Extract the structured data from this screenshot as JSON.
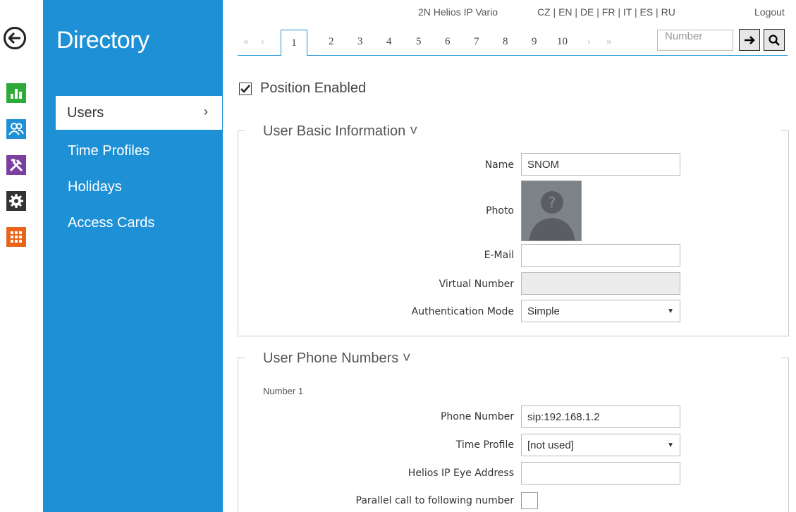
{
  "header": {
    "device_name": "2N Helios IP Vario",
    "languages": "CZ | EN | DE | FR | IT | ES | RU",
    "logout": "Logout"
  },
  "sidebar": {
    "title": "Directory",
    "items": [
      {
        "label": "Users",
        "active": true
      },
      {
        "label": "Time Profiles"
      },
      {
        "label": "Holidays"
      },
      {
        "label": "Access Cards"
      }
    ]
  },
  "rail": {
    "tiles": [
      {
        "icon": "status-chart-icon",
        "color": "#2eaa3a"
      },
      {
        "icon": "users-icon",
        "color": "#1e91d6"
      },
      {
        "icon": "tools-icon",
        "color": "#7b3fa0"
      },
      {
        "icon": "gear-icon",
        "color": "#333333"
      },
      {
        "icon": "grid-icon",
        "color": "#e8641b"
      }
    ]
  },
  "pager": {
    "first": "«",
    "prev": "‹",
    "pages": [
      "1",
      "2",
      "3",
      "4",
      "5",
      "6",
      "7",
      "8",
      "9",
      "10"
    ],
    "active": "1",
    "next": "›",
    "last": "»",
    "number_placeholder": "Number"
  },
  "content": {
    "position_enabled_label": "Position Enabled",
    "position_enabled_checked": true,
    "basic_info": {
      "title": "User Basic Information ˅",
      "name_label": "Name",
      "name_value": "SNOM",
      "photo_label": "Photo",
      "email_label": "E-Mail",
      "email_value": "",
      "virtual_number_label": "Virtual Number",
      "virtual_number_value": "",
      "auth_mode_label": "Authentication Mode",
      "auth_mode_value": "Simple"
    },
    "phone_numbers": {
      "title": "User Phone Numbers ˅",
      "number_heading": "Number 1",
      "phone_label": "Phone Number",
      "phone_value": "sip:192.168.1.2",
      "time_profile_label": "Time Profile",
      "time_profile_value": "[not used]",
      "eye_label": "Helios IP Eye Address",
      "eye_value": "",
      "parallel_label": "Parallel call to following number",
      "parallel_checked": false
    }
  },
  "colors": {
    "accent": "#1e91d6"
  }
}
